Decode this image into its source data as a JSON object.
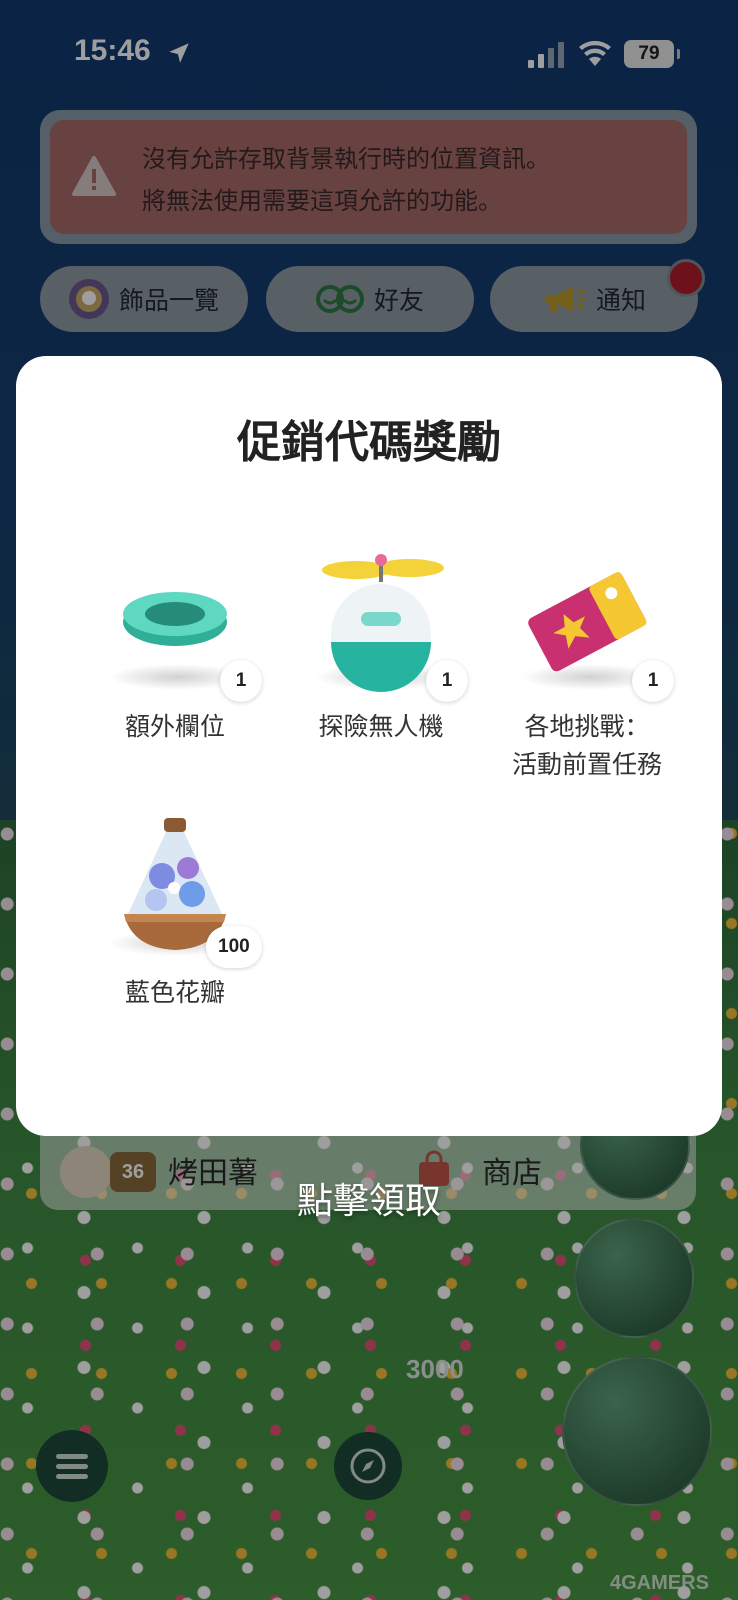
{
  "status_bar": {
    "time": "15:46",
    "battery": "79"
  },
  "warning": {
    "line1": "沒有允許存取背景執行時的位置資訊。",
    "line2": "將無法使用需要這項允許的功能。"
  },
  "nav": {
    "decor_list": "飾品一覽",
    "friends": "好友",
    "notifications": "通知"
  },
  "modal": {
    "title": "促銷代碼獎勵",
    "rewards": [
      {
        "label": "額外欄位",
        "qty": "1",
        "icon": "extra-slot-icon"
      },
      {
        "label": "探險無人機",
        "qty": "1",
        "icon": "drone-icon"
      },
      {
        "label_line1": "各地挑戰：",
        "label_line2": "活動前置任務",
        "qty": "1",
        "icon": "ticket-icon"
      },
      {
        "label": "藍色花瓣",
        "qty": "100",
        "icon": "blue-petals-icon"
      }
    ]
  },
  "profile": {
    "name": "烤田薯",
    "level": "36",
    "shop": "商店"
  },
  "claim_prompt": "點擊領取",
  "steps": "3000",
  "watermark": "4GAMERS",
  "colors": {
    "modal_bg": "#ffffff",
    "warning_bg": "#a86a6a",
    "accent_teal": "#2fbfa5"
  }
}
